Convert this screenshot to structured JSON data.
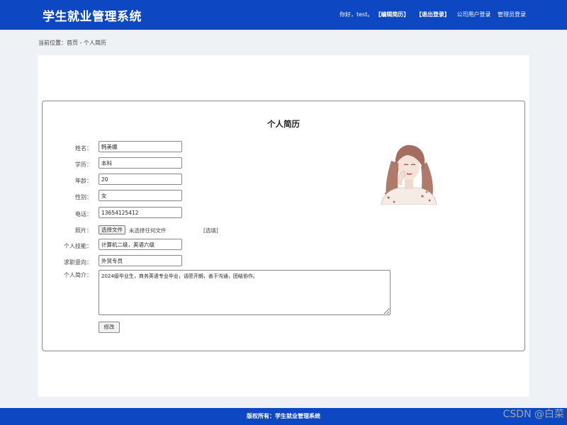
{
  "header": {
    "logo": "学生就业管理系统",
    "greeting": "你好，test。",
    "nav": [
      "【编辑简历】",
      "【退出登录】",
      "公司用户登录",
      "管理员登录"
    ]
  },
  "breadcrumb": "当前位置：首页 - 个人简历",
  "resume": {
    "title": "个人简历",
    "labels": {
      "name": "姓名：",
      "education": "学历：",
      "age": "年龄：",
      "gender": "性别：",
      "phone": "电话：",
      "photo": "照片：",
      "skills": "个人技能：",
      "intention": "求职意向：",
      "bio": "个人简介："
    },
    "values": {
      "name": "韩美娜",
      "education": "本科",
      "age": "20",
      "gender": "女",
      "phone": "13654125412",
      "skills": "计算机二级，英语六级",
      "intention": "外贸专员",
      "bio": "2024级毕业生，商务英语专业毕业，话匣开朗，善于沟通，团结协作。"
    },
    "file_button": "选择文件",
    "file_status": "未选择任何文件",
    "optional": "[选填]",
    "submit": "修改"
  },
  "footer": "版权所有：学生就业管理系统",
  "watermark": "CSDN @白菜"
}
